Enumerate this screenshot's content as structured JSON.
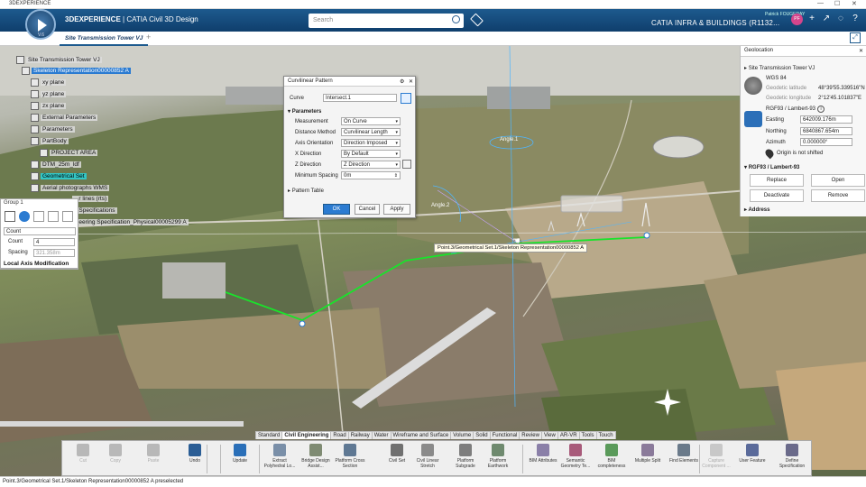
{
  "window": {
    "title": "3DEXPERIENCE",
    "controls": [
      "—",
      "☐",
      "✕"
    ]
  },
  "topbar": {
    "compass_version": "V.6",
    "brand_bold": "3DEXPERIENCE",
    "brand_rest": " | CATIA Civil 3D Design",
    "search_placeholder": "Search",
    "user": "Patrick FOUGERAY",
    "avatar": "PF",
    "app_name": "CATIA INFRA & BUILDINGS (R1132...",
    "icons": [
      "tag-icon",
      "plus-icon",
      "share-icon",
      "broadcast-icon",
      "help-icon"
    ]
  },
  "tab": {
    "label": "Site Transmission Tower VJ",
    "plus": "+"
  },
  "tree": [
    {
      "label": "Site Transmission Tower VJ",
      "style": "txt"
    },
    {
      "label": "Skeleton Representation00000852 A",
      "style": "sel"
    },
    {
      "label": "xy plane",
      "style": "txt"
    },
    {
      "label": "yz plane",
      "style": "txt"
    },
    {
      "label": "zx plane",
      "style": "txt"
    },
    {
      "label": "External Parameters",
      "style": "txt"
    },
    {
      "label": "Parameters",
      "style": "txt"
    },
    {
      "label": "PartBody",
      "style": "txt"
    },
    {
      "label": "PROJECT AREA",
      "style": "txt"
    },
    {
      "label": "DTM_25m_ldf",
      "style": "txt"
    },
    {
      "label": "Geometrical Set",
      "style": "hl"
    },
    {
      "label": "Aerial photographs WMS",
      "style": "txt"
    },
    {
      "label": "...r lines (rts)",
      "style": "txt"
    },
    {
      "label": "...Specifications",
      "style": "txt"
    },
    {
      "label": "...eering Specification_Physical00005299 A",
      "style": "txt"
    }
  ],
  "group1": {
    "title": "Group 1",
    "mode": "Count",
    "count_label": "Count",
    "count_value": "4",
    "spacing_label": "Spacing",
    "spacing_value": "321.358m",
    "local_axis": "Local Axis Modification"
  },
  "curvilinear": {
    "title": "Curvilinear Pattern",
    "curve_label": "Curve",
    "curve_value": "Intersect.1",
    "section": "Parameters",
    "rows": [
      {
        "label": "Measurement",
        "value": "On Curve"
      },
      {
        "label": "Distance Method",
        "value": "Curvilinear Length"
      },
      {
        "label": "Axis Orientation",
        "value": "Direction Imposed"
      },
      {
        "label": "X Direction",
        "value": "By Default"
      },
      {
        "label": "Z Direction",
        "value": "Z Direction"
      },
      {
        "label": "Minimum Spacing",
        "value": "0m"
      }
    ],
    "pattern_table": "Pattern Table",
    "ok": "OK",
    "cancel": "Cancel",
    "apply": "Apply"
  },
  "geolocation": {
    "title": "Geolocation",
    "site": "Site Transmission Tower VJ",
    "wgs_label": "WGS 84",
    "lat_label": "Geodetic latitude",
    "lat_value": "48°39'55.339516\"N",
    "lon_label": "Geodetic longitude",
    "lon_value": "2°12'45.101837\"E",
    "crs": "RGF93 / Lambert-93",
    "easting_label": "Easting",
    "easting_value": "642009.176m",
    "northing_label": "Northing",
    "northing_value": "6840867.654m",
    "azimuth_label": "Azimuth",
    "azimuth_value": "0.000000°",
    "shift_note": "Origin is not shifted",
    "section2": "RGF93 / Lambert-93",
    "replace": "Replace",
    "open": "Open",
    "deactivate": "Deactivate",
    "remove": "Remove",
    "address": "Address"
  },
  "viewport": {
    "tooltip": "Point.3/Geometrical Set.1/Skeleton Representation00000852 A",
    "angle1": "Angle.1",
    "angle2": "Angle.2"
  },
  "action_tabs": [
    "Standard",
    "Civil Engineering",
    "Road",
    "Railway",
    "Water",
    "Wireframe and Surface",
    "Volume",
    "Solid",
    "Functional",
    "Review",
    "View",
    "AR-VR",
    "Tools",
    "Touch"
  ],
  "active_tab": "Civil Engineering",
  "tools": [
    {
      "label": "Cut",
      "icon": "scissors-icon",
      "color": "#b8b8b8",
      "disabled": true
    },
    {
      "label": "Copy",
      "icon": "copy-icon",
      "color": "#b8b8b8",
      "disabled": true
    },
    {
      "label": "Paste",
      "icon": "paste-icon",
      "color": "#b8b8b8",
      "disabled": true
    },
    {
      "label": "Undo",
      "icon": "undo-icon",
      "color": "#2a5d95",
      "disabled": false
    },
    {
      "label": "Update",
      "icon": "update-icon",
      "color": "#2a6fb8",
      "disabled": false
    },
    {
      "label": "Extract Polyhedral Lo...",
      "icon": "extract-icon",
      "color": "#7a8fa8",
      "disabled": false
    },
    {
      "label": "Bridge Design Assist...",
      "icon": "bridge-icon",
      "color": "#7f8b73",
      "disabled": false
    },
    {
      "label": "Platform Cross Section",
      "icon": "platform-section-icon",
      "color": "#5f7893",
      "disabled": false
    },
    {
      "label": "Civil Set",
      "icon": "civil-set-icon",
      "color": "#707070",
      "disabled": false
    },
    {
      "label": "Civil Linear Stretch",
      "icon": "linear-stretch-icon",
      "color": "#8a8a8a",
      "disabled": false
    },
    {
      "label": "Platform Subgrade",
      "icon": "subgrade-icon",
      "color": "#7d7d7d",
      "disabled": false
    },
    {
      "label": "Platform Earthwork",
      "icon": "earthwork-icon",
      "color": "#6f8a6f",
      "disabled": false
    },
    {
      "label": "BIM Attributes",
      "icon": "bim-attributes-icon",
      "color": "#8a7fa8",
      "disabled": false
    },
    {
      "label": "Semantic Geometry Te...",
      "icon": "semantic-icon",
      "color": "#a85a7a",
      "disabled": false
    },
    {
      "label": "BIM completeness",
      "icon": "bim-completeness-icon",
      "color": "#5a9a5a",
      "disabled": false
    },
    {
      "label": "Multiple Split",
      "icon": "split-icon",
      "color": "#8a7a9a",
      "disabled": false
    },
    {
      "label": "Find Elements",
      "icon": "find-icon",
      "color": "#6a7a8a",
      "disabled": false
    },
    {
      "label": "Capture Component ...",
      "icon": "capture-icon",
      "color": "#c8c8c8",
      "disabled": true
    },
    {
      "label": "User Feature",
      "icon": "user-feature-icon",
      "color": "#5a6a9a",
      "disabled": false
    },
    {
      "label": "Define Specification",
      "icon": "define-spec-icon",
      "color": "#6a6a8a",
      "disabled": false
    }
  ],
  "status": "Point.3/Geometrical Set.1/Skeleton Representation00000852 A preselected"
}
